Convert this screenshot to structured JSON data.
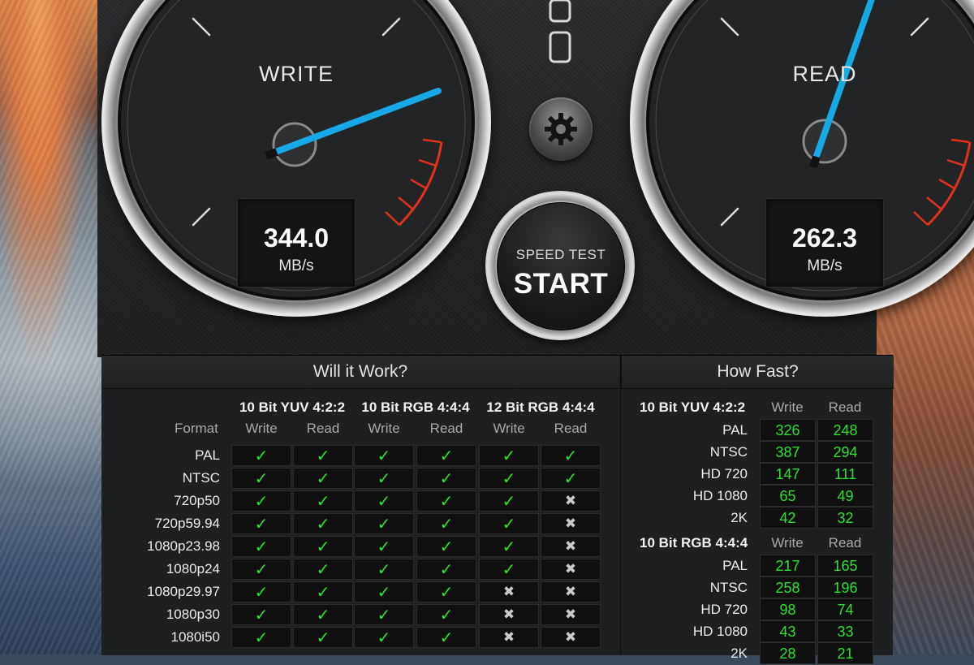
{
  "write_gauge": {
    "title": "WRITE",
    "value": "344.0",
    "unit": "MB/s"
  },
  "read_gauge": {
    "title": "READ",
    "value": "262.3",
    "unit": "MB/s"
  },
  "start_button": {
    "caption": "SPEED TEST",
    "label": "START"
  },
  "icons": {
    "settings": "gear-icon",
    "check": "check-icon",
    "cross": "cross-icon",
    "logo": "blackmagic-logo-icon"
  },
  "colors": {
    "needle": "#17a9e6",
    "ok": "#2ee02e",
    "redline": "#e0301e"
  },
  "will_it_work": {
    "title": "Will it Work?",
    "format_label": "Format",
    "groups": [
      {
        "name": "10 Bit YUV 4:2:2",
        "write": "Write",
        "read": "Read"
      },
      {
        "name": "10 Bit RGB 4:4:4",
        "write": "Write",
        "read": "Read"
      },
      {
        "name": "12 Bit RGB 4:4:4",
        "write": "Write",
        "read": "Read"
      }
    ],
    "rows": [
      {
        "format": "PAL",
        "marks": [
          true,
          true,
          true,
          true,
          true,
          true
        ]
      },
      {
        "format": "NTSC",
        "marks": [
          true,
          true,
          true,
          true,
          true,
          true
        ]
      },
      {
        "format": "720p50",
        "marks": [
          true,
          true,
          true,
          true,
          true,
          false
        ]
      },
      {
        "format": "720p59.94",
        "marks": [
          true,
          true,
          true,
          true,
          true,
          false
        ]
      },
      {
        "format": "1080p23.98",
        "marks": [
          true,
          true,
          true,
          true,
          true,
          false
        ]
      },
      {
        "format": "1080p24",
        "marks": [
          true,
          true,
          true,
          true,
          true,
          false
        ]
      },
      {
        "format": "1080p29.97",
        "marks": [
          true,
          true,
          true,
          true,
          false,
          false
        ]
      },
      {
        "format": "1080p30",
        "marks": [
          true,
          true,
          true,
          true,
          false,
          false
        ]
      },
      {
        "format": "1080i50",
        "marks": [
          true,
          true,
          true,
          true,
          false,
          false
        ]
      }
    ]
  },
  "how_fast": {
    "title": "How Fast?",
    "groups": [
      {
        "name": "10 Bit YUV 4:2:2",
        "write": "Write",
        "read": "Read",
        "rows": [
          {
            "format": "PAL",
            "write": "326",
            "read": "248"
          },
          {
            "format": "NTSC",
            "write": "387",
            "read": "294"
          },
          {
            "format": "HD 720",
            "write": "147",
            "read": "111"
          },
          {
            "format": "HD 1080",
            "write": "65",
            "read": "49"
          },
          {
            "format": "2K",
            "write": "42",
            "read": "32"
          }
        ]
      },
      {
        "name": "10 Bit RGB 4:4:4",
        "write": "Write",
        "read": "Read",
        "rows": [
          {
            "format": "PAL",
            "write": "217",
            "read": "165"
          },
          {
            "format": "NTSC",
            "write": "258",
            "read": "196"
          },
          {
            "format": "HD 720",
            "write": "98",
            "read": "74"
          },
          {
            "format": "HD 1080",
            "write": "43",
            "read": "33"
          },
          {
            "format": "2K",
            "write": "28",
            "read": "21"
          }
        ]
      }
    ]
  }
}
